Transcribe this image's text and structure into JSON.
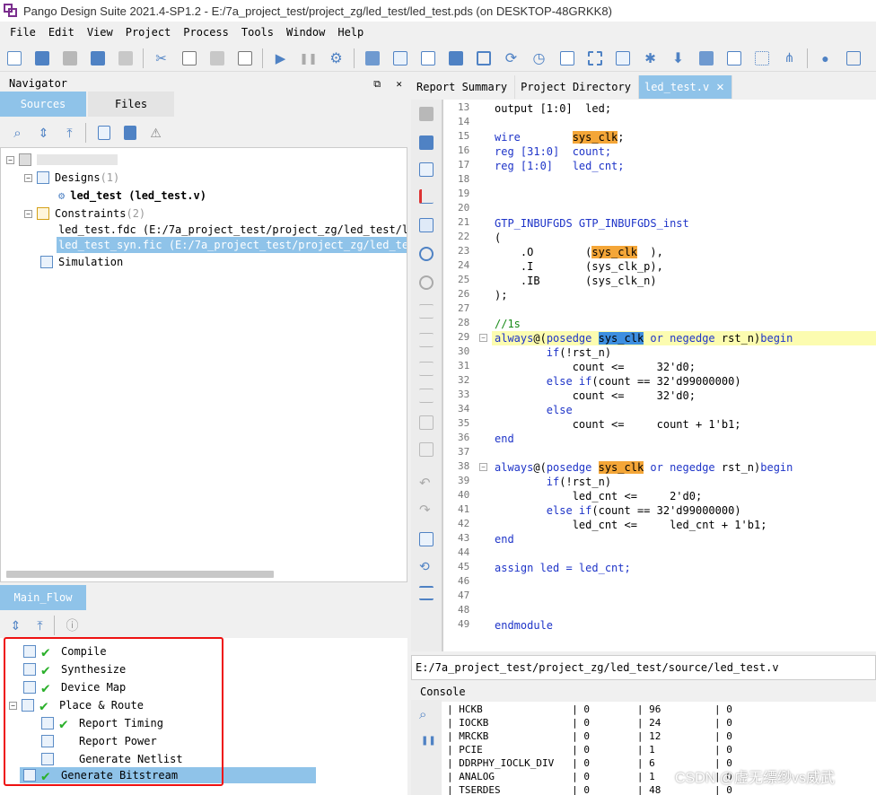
{
  "window": {
    "title": "Pango Design Suite 2021.4-SP1.2 - E:/7a_project_test/project_zg/led_test/led_test.pds (on DESKTOP-48GRKK8)"
  },
  "menu": [
    "File",
    "Edit",
    "View",
    "Project",
    "Process",
    "Tools",
    "Window",
    "Help"
  ],
  "navigator": {
    "title": "Navigator",
    "float_glyph": "⧉",
    "close_glyph": "✕",
    "tabs": [
      "Sources",
      "Files"
    ],
    "tree": {
      "designs_label": "Designs",
      "designs_count": "(1)",
      "top_module": "led_test (led_test.v)",
      "constraints_label": "Constraints",
      "constraints_count": "(2)",
      "fdc_file": "led_test.fdc (E:/7a_project_test/project_zg/led_test/led",
      "fic_file": "led_test_syn.fic (E:/7a_project_test/project_zg/led_test",
      "simulation_label": "Simulation"
    }
  },
  "main_flow": {
    "tab": "Main_Flow",
    "steps": [
      {
        "label": "Compile",
        "done": true
      },
      {
        "label": "Synthesize",
        "done": true
      },
      {
        "label": "Device Map",
        "done": true
      },
      {
        "label": "Place & Route",
        "done": true
      },
      {
        "label": "Report Timing",
        "done": true
      },
      {
        "label": "Report Power",
        "done": false
      },
      {
        "label": "Generate Netlist",
        "done": false
      },
      {
        "label": "Generate Bitstream",
        "done": true
      }
    ]
  },
  "editor": {
    "tabs": [
      "Report Summary",
      "Project Directory",
      "led_test.v"
    ],
    "active_tab": "led_test.v",
    "close_glyph": "✕",
    "line_numbers": [
      "13",
      "14",
      "15",
      "16",
      "17",
      "18",
      "19",
      "20",
      "21",
      "22",
      "23",
      "24",
      "25",
      "26",
      "27",
      "28",
      "29",
      "30",
      "31",
      "32",
      "33",
      "34",
      "35",
      "36",
      "37",
      "38",
      "39",
      "40",
      "41",
      "42",
      "43",
      "44",
      "45",
      "46",
      "47",
      "48",
      "49"
    ],
    "code": {
      "l13a": "output [1:0]  led;",
      "l15a": "wire        ",
      "l15b": "sys_clk",
      "l15c": ";",
      "l16a": "reg [31:0]  count;",
      "l17a": "reg [1:0]   led_cnt;",
      "l21a": "GTP_INBUFGDS GTP_INBUFGDS_inst",
      "l22a": "(",
      "l23a": "    .O        (",
      "l23b": "sys_clk",
      "l23c": "  ),",
      "l24a": "    .I        (sys_clk_p),",
      "l25a": "    .IB       (sys_clk_n)",
      "l26a": ");",
      "l28a": "//1s",
      "l29a": "always",
      "l29b": "@(",
      "l29c": "posedge ",
      "l29d": "sys_clk",
      "l29e": " or negedge ",
      "l29f": "rst_n)",
      "l29g": "begin",
      "l30a": "        ",
      "l30b": "if",
      "l30c": "(!rst_n)",
      "l31a": "            count <=     32'd0;",
      "l32a": "        ",
      "l32b": "else if",
      "l32c": "(count == 32'd99000000)",
      "l33a": "            count <=     32'd0;",
      "l34a": "        ",
      "l34b": "else",
      "l35a": "            count <=     count + 1'b1;",
      "l36a": "end",
      "l38a": "always",
      "l38b": "@(",
      "l38c": "posedge ",
      "l38d": "sys_clk",
      "l38e": " or negedge ",
      "l38f": "rst_n)",
      "l38g": "begin",
      "l39a": "        ",
      "l39b": "if",
      "l39c": "(!rst_n)",
      "l40a": "            led_cnt <=     2'd0;",
      "l41a": "        ",
      "l41b": "else if",
      "l41c": "(count == 32'd99000000)",
      "l42a": "            led_cnt <=     led_cnt + 1'b1;",
      "l43a": "end",
      "l45a": "assign led = led_cnt;",
      "l49a": "endmodule"
    },
    "path": "E:/7a_project_test/project_zg/led_test/source/led_test.v"
  },
  "console": {
    "label": "Console",
    "rows": [
      "| HCKB               | 0        | 96         | 0",
      "| IOCKB              | 0        | 24         | 0",
      "| MRCKB              | 0        | 12         | 0",
      "| PCIE               | 0        | 1          | 0",
      "| DDRPHY_IOCLK_DIV   | 0        | 6          | 0",
      "| ANALOG             | 0        | 1          | 0",
      "| TSERDES            | 0        | 48         | 0"
    ]
  },
  "watermark": "CSDN @虚无缥缈vs威武",
  "colors": {
    "accent": "#8fc3e9",
    "check": "#2bb02b",
    "keyword": "#1e34c8",
    "highlight_orange": "#f4a638",
    "highlight_blue": "#3d8fe0",
    "current_line": "#fcfcb0",
    "annotation_red": "#e11111"
  }
}
